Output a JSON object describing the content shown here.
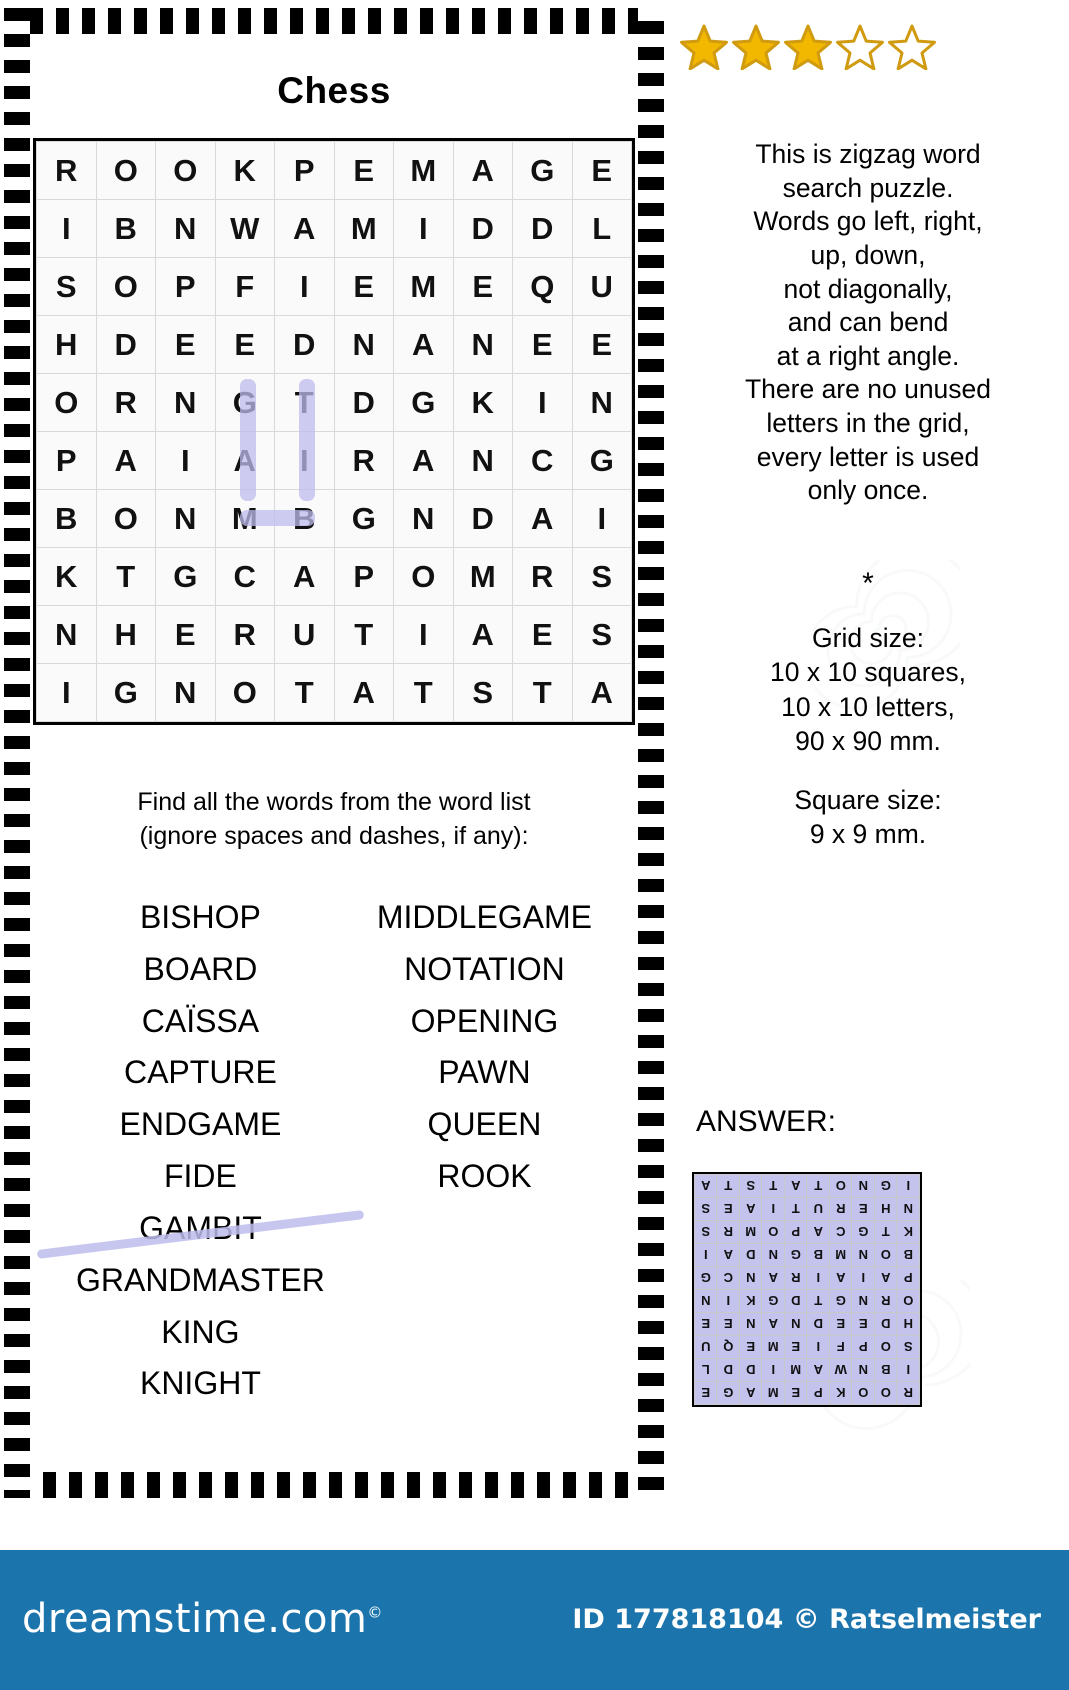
{
  "title": "Chess",
  "rating": {
    "filled": 3,
    "total": 5,
    "fill_color": "#f2b800",
    "stroke_color": "#d09b10"
  },
  "grid": {
    "rows": [
      [
        "R",
        "O",
        "O",
        "K",
        "P",
        "E",
        "M",
        "A",
        "G",
        "E"
      ],
      [
        "I",
        "B",
        "N",
        "W",
        "A",
        "M",
        "I",
        "D",
        "D",
        "L"
      ],
      [
        "S",
        "O",
        "P",
        "F",
        "I",
        "E",
        "M",
        "E",
        "Q",
        "U"
      ],
      [
        "H",
        "D",
        "E",
        "E",
        "D",
        "N",
        "A",
        "N",
        "E",
        "E"
      ],
      [
        "O",
        "R",
        "N",
        "G",
        "T",
        "D",
        "G",
        "K",
        "I",
        "N"
      ],
      [
        "P",
        "A",
        "I",
        "A",
        "I",
        "R",
        "A",
        "N",
        "C",
        "G"
      ],
      [
        "B",
        "O",
        "N",
        "M",
        "B",
        "G",
        "N",
        "D",
        "A",
        "I"
      ],
      [
        "K",
        "T",
        "G",
        "C",
        "A",
        "P",
        "O",
        "M",
        "R",
        "S"
      ],
      [
        "N",
        "H",
        "E",
        "R",
        "U",
        "T",
        "I",
        "A",
        "E",
        "S"
      ],
      [
        "I",
        "G",
        "N",
        "O",
        "T",
        "A",
        "T",
        "S",
        "T",
        "A"
      ]
    ],
    "highlight_color": "#bdbcec"
  },
  "find_instructions": [
    "Find all the words from the word list",
    "(ignore spaces and dashes, if any):"
  ],
  "word_list": {
    "left": [
      {
        "word": "BISHOP",
        "struck": false
      },
      {
        "word": "BOARD",
        "struck": false
      },
      {
        "word": "CAÏSSA",
        "struck": false
      },
      {
        "word": "CAPTURE",
        "struck": false
      },
      {
        "word": "ENDGAME",
        "struck": false
      },
      {
        "word": "FIDE",
        "struck": false
      },
      {
        "word": "GAMBIT",
        "struck": true
      },
      {
        "word": "GRANDMASTER",
        "struck": false
      },
      {
        "word": "KING",
        "struck": false
      },
      {
        "word": "KNIGHT",
        "struck": false
      }
    ],
    "right": [
      {
        "word": "MIDDLEGAME",
        "struck": false
      },
      {
        "word": "NOTATION",
        "struck": false
      },
      {
        "word": "OPENING",
        "struck": false
      },
      {
        "word": "PAWN",
        "struck": false
      },
      {
        "word": "QUEEN",
        "struck": false
      },
      {
        "word": "ROOK",
        "struck": false
      }
    ]
  },
  "about": {
    "lines": [
      "This is zigzag word",
      "search puzzle.",
      "Words go left, right,",
      "up, down,",
      "not diagonally,",
      "and can bend",
      "at a right angle.",
      "There are no unused",
      "letters in the grid,",
      "every letter is used",
      "only once."
    ]
  },
  "meta": {
    "separator": "*",
    "grid_size_label": "Grid size:",
    "grid_size_squares": "10 x 10 squares,",
    "grid_size_letters": "10 x 10 letters,",
    "grid_size_mm": "90 x 90 mm.",
    "square_size_label": "Square size:",
    "square_size_mm": "9 x 9 mm."
  },
  "answer": {
    "label": "ANSWER:",
    "rows": [
      [
        "R",
        "O",
        "O",
        "K",
        "P",
        "E",
        "M",
        "A",
        "G",
        "E"
      ],
      [
        "I",
        "B",
        "N",
        "W",
        "A",
        "M",
        "I",
        "D",
        "D",
        "L"
      ],
      [
        "S",
        "O",
        "P",
        "F",
        "I",
        "E",
        "M",
        "E",
        "Q",
        "U"
      ],
      [
        "H",
        "D",
        "E",
        "E",
        "D",
        "N",
        "A",
        "N",
        "E",
        "E"
      ],
      [
        "O",
        "R",
        "N",
        "G",
        "T",
        "D",
        "G",
        "K",
        "I",
        "N"
      ],
      [
        "P",
        "A",
        "I",
        "A",
        "I",
        "R",
        "A",
        "N",
        "C",
        "G"
      ],
      [
        "B",
        "O",
        "N",
        "M",
        "B",
        "G",
        "N",
        "D",
        "A",
        "I"
      ],
      [
        "K",
        "T",
        "G",
        "C",
        "A",
        "P",
        "O",
        "M",
        "R",
        "S"
      ],
      [
        "N",
        "H",
        "E",
        "R",
        "U",
        "T",
        "I",
        "A",
        "E",
        "S"
      ],
      [
        "I",
        "G",
        "N",
        "O",
        "T",
        "A",
        "T",
        "S",
        "T",
        "A"
      ]
    ],
    "highlight": [
      [
        1,
        1,
        1,
        1,
        1,
        1,
        1,
        1,
        1,
        1
      ],
      [
        1,
        1,
        1,
        1,
        1,
        1,
        1,
        1,
        1,
        1
      ],
      [
        1,
        1,
        1,
        1,
        1,
        1,
        1,
        1,
        1,
        1
      ],
      [
        1,
        1,
        1,
        1,
        1,
        1,
        1,
        1,
        1,
        1
      ],
      [
        1,
        1,
        1,
        1,
        1,
        1,
        1,
        1,
        1,
        1
      ],
      [
        1,
        1,
        1,
        1,
        1,
        1,
        1,
        1,
        1,
        1
      ],
      [
        1,
        1,
        1,
        1,
        1,
        1,
        1,
        1,
        1,
        1
      ],
      [
        1,
        1,
        1,
        1,
        1,
        1,
        1,
        1,
        1,
        1
      ],
      [
        1,
        1,
        1,
        1,
        1,
        1,
        1,
        1,
        1,
        1
      ],
      [
        1,
        1,
        1,
        1,
        1,
        1,
        1,
        1,
        1,
        1
      ]
    ],
    "highlight_color": "#c4c3ee"
  },
  "footer": {
    "brand": "dreamstime.com",
    "credit": "ID 177818104 © Ratselmeister",
    "background": "#1b75ac"
  }
}
